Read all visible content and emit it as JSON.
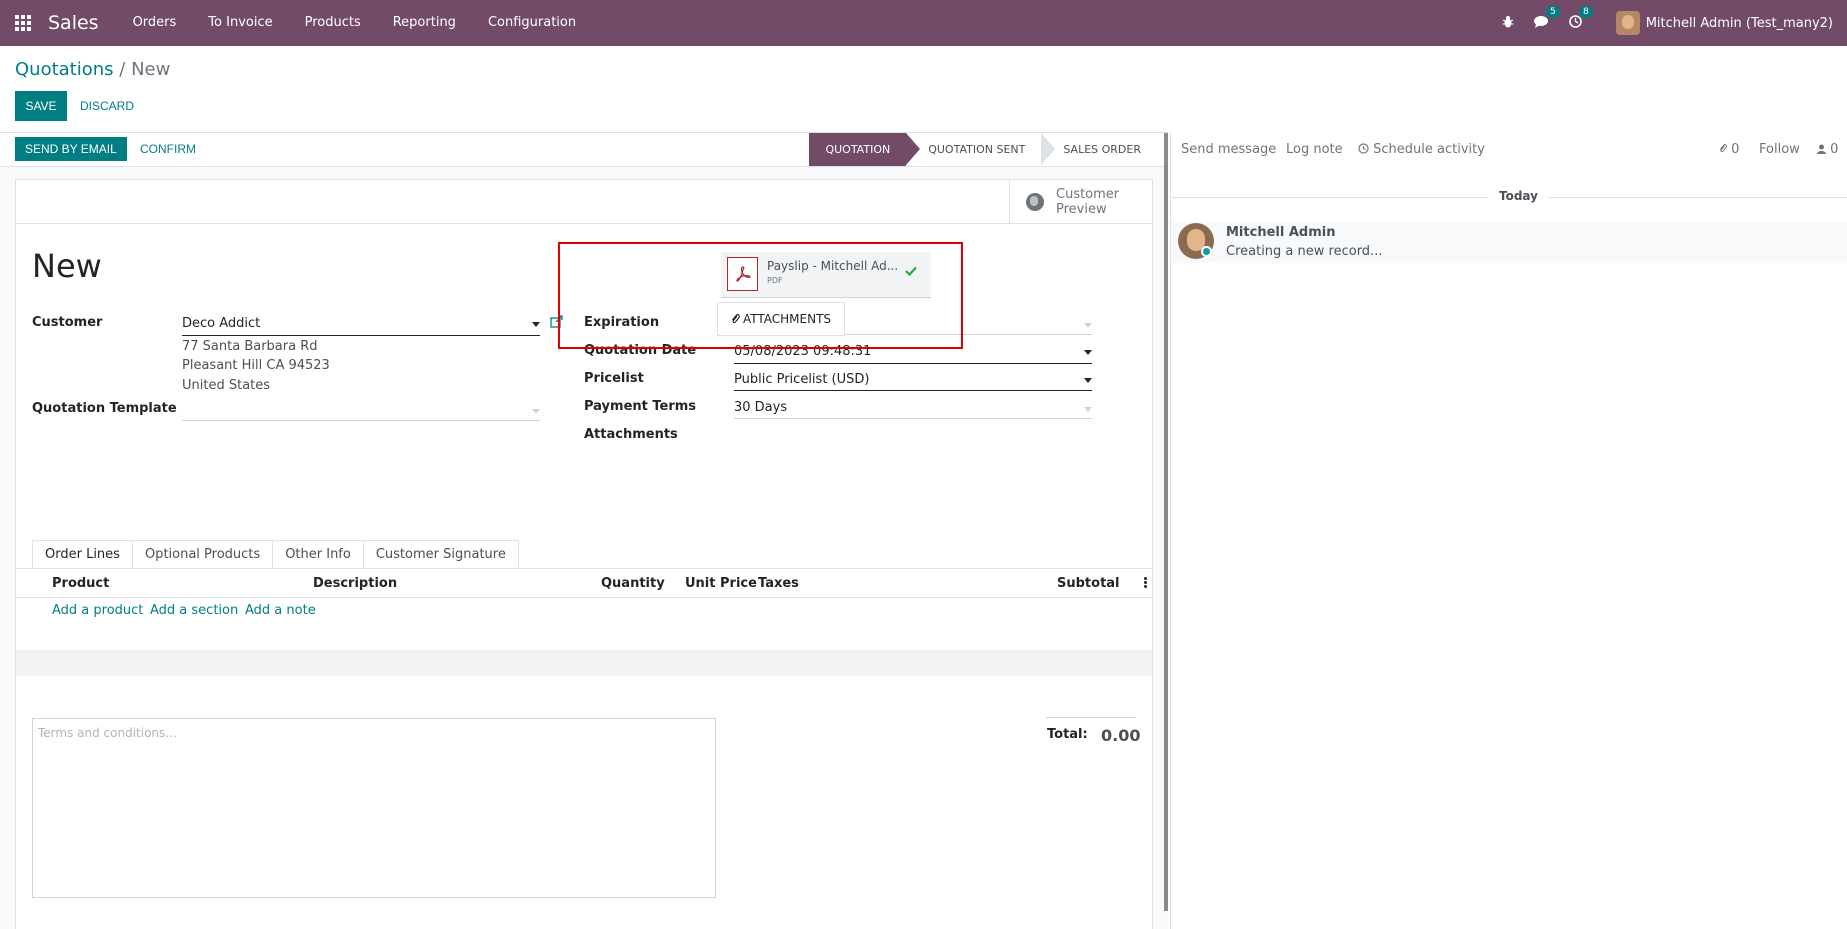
{
  "navbar": {
    "app_name": "Sales",
    "menu": [
      "Orders",
      "To Invoice",
      "Products",
      "Reporting",
      "Configuration"
    ],
    "messages_badge": "5",
    "activities_badge": "8",
    "user": "Mitchell Admin (Test_many2)",
    "icons": [
      "apps-grid-icon",
      "bug-icon",
      "chat-icon",
      "clock-icon"
    ]
  },
  "breadcrumb": {
    "parent": "Quotations",
    "separator": "/",
    "current": "New"
  },
  "actions": {
    "save": "SAVE",
    "discard": "DISCARD"
  },
  "statusbar": {
    "send_email": "SEND BY EMAIL",
    "confirm": "CONFIRM",
    "stages": [
      "QUOTATION",
      "QUOTATION SENT",
      "SALES ORDER"
    ],
    "active_stage": "QUOTATION"
  },
  "form": {
    "preview_label_1": "Customer",
    "preview_label_2": "Preview",
    "title": "New",
    "customer_label": "Customer",
    "customer_value": "Deco Addict",
    "address_line1": "77 Santa Barbara Rd",
    "address_line2": "Pleasant Hill CA 94523",
    "address_line3": "United States",
    "template_label": "Quotation Template",
    "template_value": "",
    "expiration_label": "Expiration",
    "expiration_value": "",
    "quotation_date_label": "Quotation Date",
    "quotation_date_value": "05/08/2023 09:48:31",
    "pricelist_label": "Pricelist",
    "pricelist_value": "Public Pricelist (USD)",
    "payment_terms_label": "Payment Terms",
    "payment_terms_value": "30 Days",
    "attachments_label": "Attachments",
    "attachment_name": "Payslip - Mitchell Ad...",
    "attachment_type": "PDF",
    "attachments_button": "ATTACHMENTS"
  },
  "tabs": [
    "Order Lines",
    "Optional Products",
    "Other Info",
    "Customer Signature"
  ],
  "table": {
    "columns": [
      "Product",
      "Description",
      "Quantity",
      "Unit Price",
      "Taxes",
      "Subtotal"
    ],
    "add_product": "Add a product",
    "add_section": "Add a section",
    "add_note": "Add a note"
  },
  "footer": {
    "terms_placeholder": "Terms and conditions...",
    "total_label": "Total:",
    "total_value": "0.00"
  },
  "chatter": {
    "send_message": "Send message",
    "log_note": "Log note",
    "schedule_activity": "Schedule activity",
    "attachments_count": "0",
    "follow": "Follow",
    "followers_count": "0",
    "date_separator": "Today",
    "author": "Mitchell Admin",
    "body": "Creating a new record..."
  },
  "colors": {
    "brand": "#714B67",
    "primary": "#017e84",
    "highlight": "#e00000"
  }
}
